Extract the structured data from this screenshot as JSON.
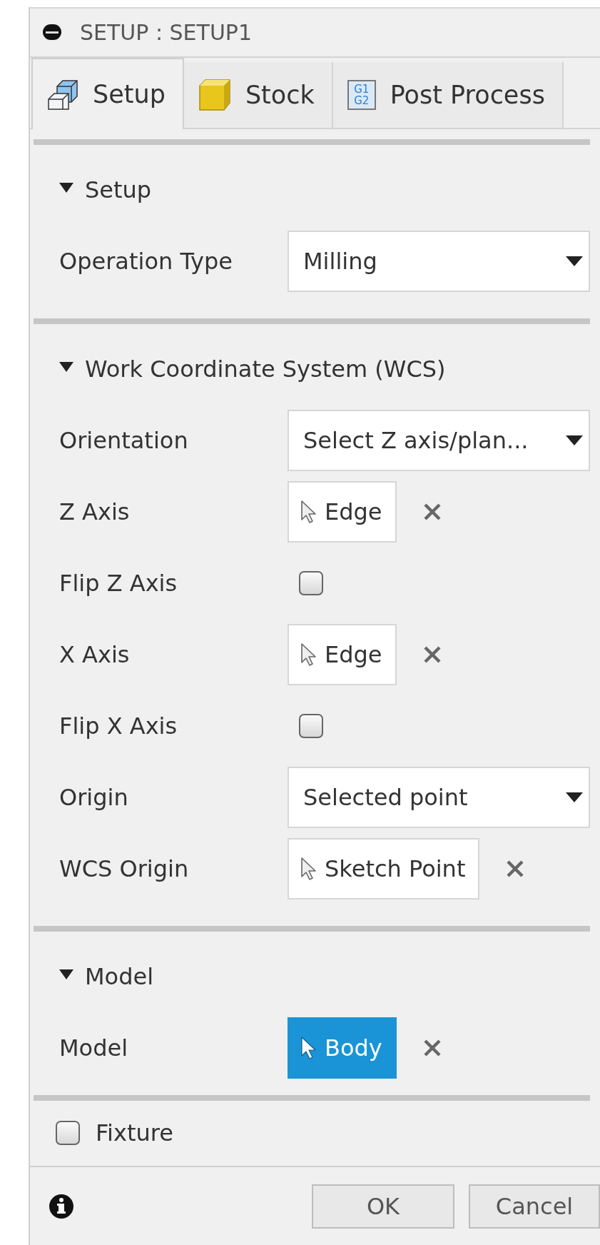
{
  "window": {
    "title": "SETUP : SETUP1"
  },
  "tabs": [
    {
      "label": "Setup",
      "selected": true
    },
    {
      "label": "Stock",
      "selected": false
    },
    {
      "label": "Post Process",
      "selected": false,
      "icon_text": [
        "G1",
        "G2"
      ]
    }
  ],
  "sections": [
    {
      "title": "Setup",
      "expanded": true,
      "rows": [
        {
          "kind": "dropdown",
          "label": "Operation Type",
          "value": "Milling"
        }
      ]
    },
    {
      "title": "Work Coordinate System (WCS)",
      "expanded": true,
      "rows": [
        {
          "kind": "dropdown",
          "label": "Orientation",
          "value": "Select Z axis/plan..."
        },
        {
          "kind": "selection",
          "label": "Z Axis",
          "value": "Edge",
          "active": false
        },
        {
          "kind": "checkbox",
          "label": "Flip Z Axis",
          "checked": false
        },
        {
          "kind": "selection",
          "label": "X Axis",
          "value": "Edge",
          "active": false
        },
        {
          "kind": "checkbox",
          "label": "Flip X Axis",
          "checked": false
        },
        {
          "kind": "dropdown",
          "label": "Origin",
          "value": "Selected point"
        },
        {
          "kind": "selection",
          "label": "WCS Origin",
          "value": "Sketch Point",
          "active": false
        }
      ]
    },
    {
      "title": "Model",
      "expanded": true,
      "rows": [
        {
          "kind": "selection",
          "label": "Model",
          "value": "Body",
          "active": true
        }
      ]
    }
  ],
  "fixture": {
    "label": "Fixture",
    "checked": false
  },
  "buttons": [
    "OK",
    "Cancel"
  ]
}
